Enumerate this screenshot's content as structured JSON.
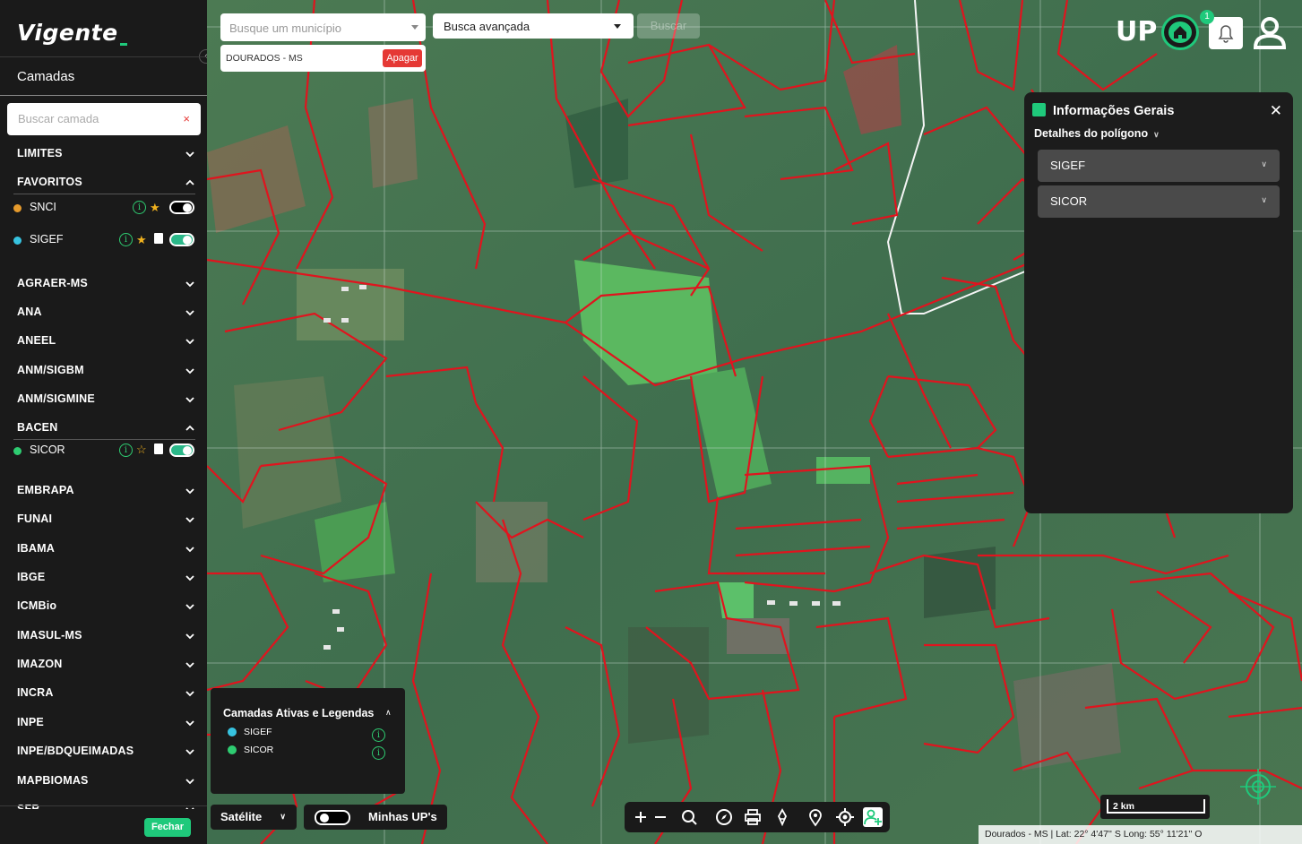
{
  "sidebar": {
    "logo": "Vigente",
    "title": "Camadas",
    "search_placeholder": "Buscar camada",
    "search_clear": "×",
    "groups": [
      {
        "label": "LIMITES",
        "expanded": false
      },
      {
        "label": "FAVORITOS",
        "expanded": true
      },
      {
        "label": "AGRAER-MS",
        "expanded": false
      },
      {
        "label": "ANA",
        "expanded": false
      },
      {
        "label": "ANEEL",
        "expanded": false
      },
      {
        "label": "ANM/SIGBM",
        "expanded": false
      },
      {
        "label": "ANM/SIGMINE",
        "expanded": false
      },
      {
        "label": "BACEN",
        "expanded": true
      },
      {
        "label": "EMBRAPA",
        "expanded": false
      },
      {
        "label": "FUNAI",
        "expanded": false
      },
      {
        "label": "IBAMA",
        "expanded": false
      },
      {
        "label": "IBGE",
        "expanded": false
      },
      {
        "label": "ICMBio",
        "expanded": false
      },
      {
        "label": "IMASUL-MS",
        "expanded": false
      },
      {
        "label": "IMAZON",
        "expanded": false
      },
      {
        "label": "INCRA",
        "expanded": false
      },
      {
        "label": "INPE",
        "expanded": false
      },
      {
        "label": "INPE/BDQUEIMADAS",
        "expanded": false
      },
      {
        "label": "MAPBIOMAS",
        "expanded": false
      },
      {
        "label": "SFB",
        "expanded": false
      }
    ],
    "favorite_layers": [
      {
        "label": "SNCI",
        "color": "#e59a2c",
        "favorite": true,
        "enabled": false
      },
      {
        "label": "SIGEF",
        "color": "#37c3e0",
        "favorite": true,
        "enabled": true
      }
    ],
    "bacen_layers": [
      {
        "label": "SICOR",
        "color": "#2ecc71",
        "favorite": false,
        "enabled": true
      }
    ],
    "close_button": "Fechar"
  },
  "map": {
    "municipality_search_placeholder": "Busque um município",
    "selected_municipality": "DOURADOS - MS",
    "clear_button": "Apagar",
    "advanced_search": "Busca avançada",
    "search_button": "Buscar",
    "brand": "UP",
    "notification_count": "1",
    "info_panel": {
      "title": "Informações Gerais",
      "subtitle": "Detalhes do polígono",
      "sections": [
        "SIGEF",
        "SICOR"
      ]
    },
    "legend": {
      "title": "Camadas Ativas e Legendas",
      "items": [
        {
          "label": "SIGEF",
          "color": "#37c3e0"
        },
        {
          "label": "SICOR",
          "color": "#2ecc71"
        }
      ]
    },
    "basemap": "Satélite",
    "my_ups": "Minhas UP's",
    "scale": "2 km",
    "coordinates": "Dourados - MS | Lat: 22° 4'47'' S Long: 55° 11'21'' O",
    "colors": {
      "accent": "#1fc97b",
      "parcel_outline": "#e0141e",
      "danger": "#e53935"
    }
  }
}
